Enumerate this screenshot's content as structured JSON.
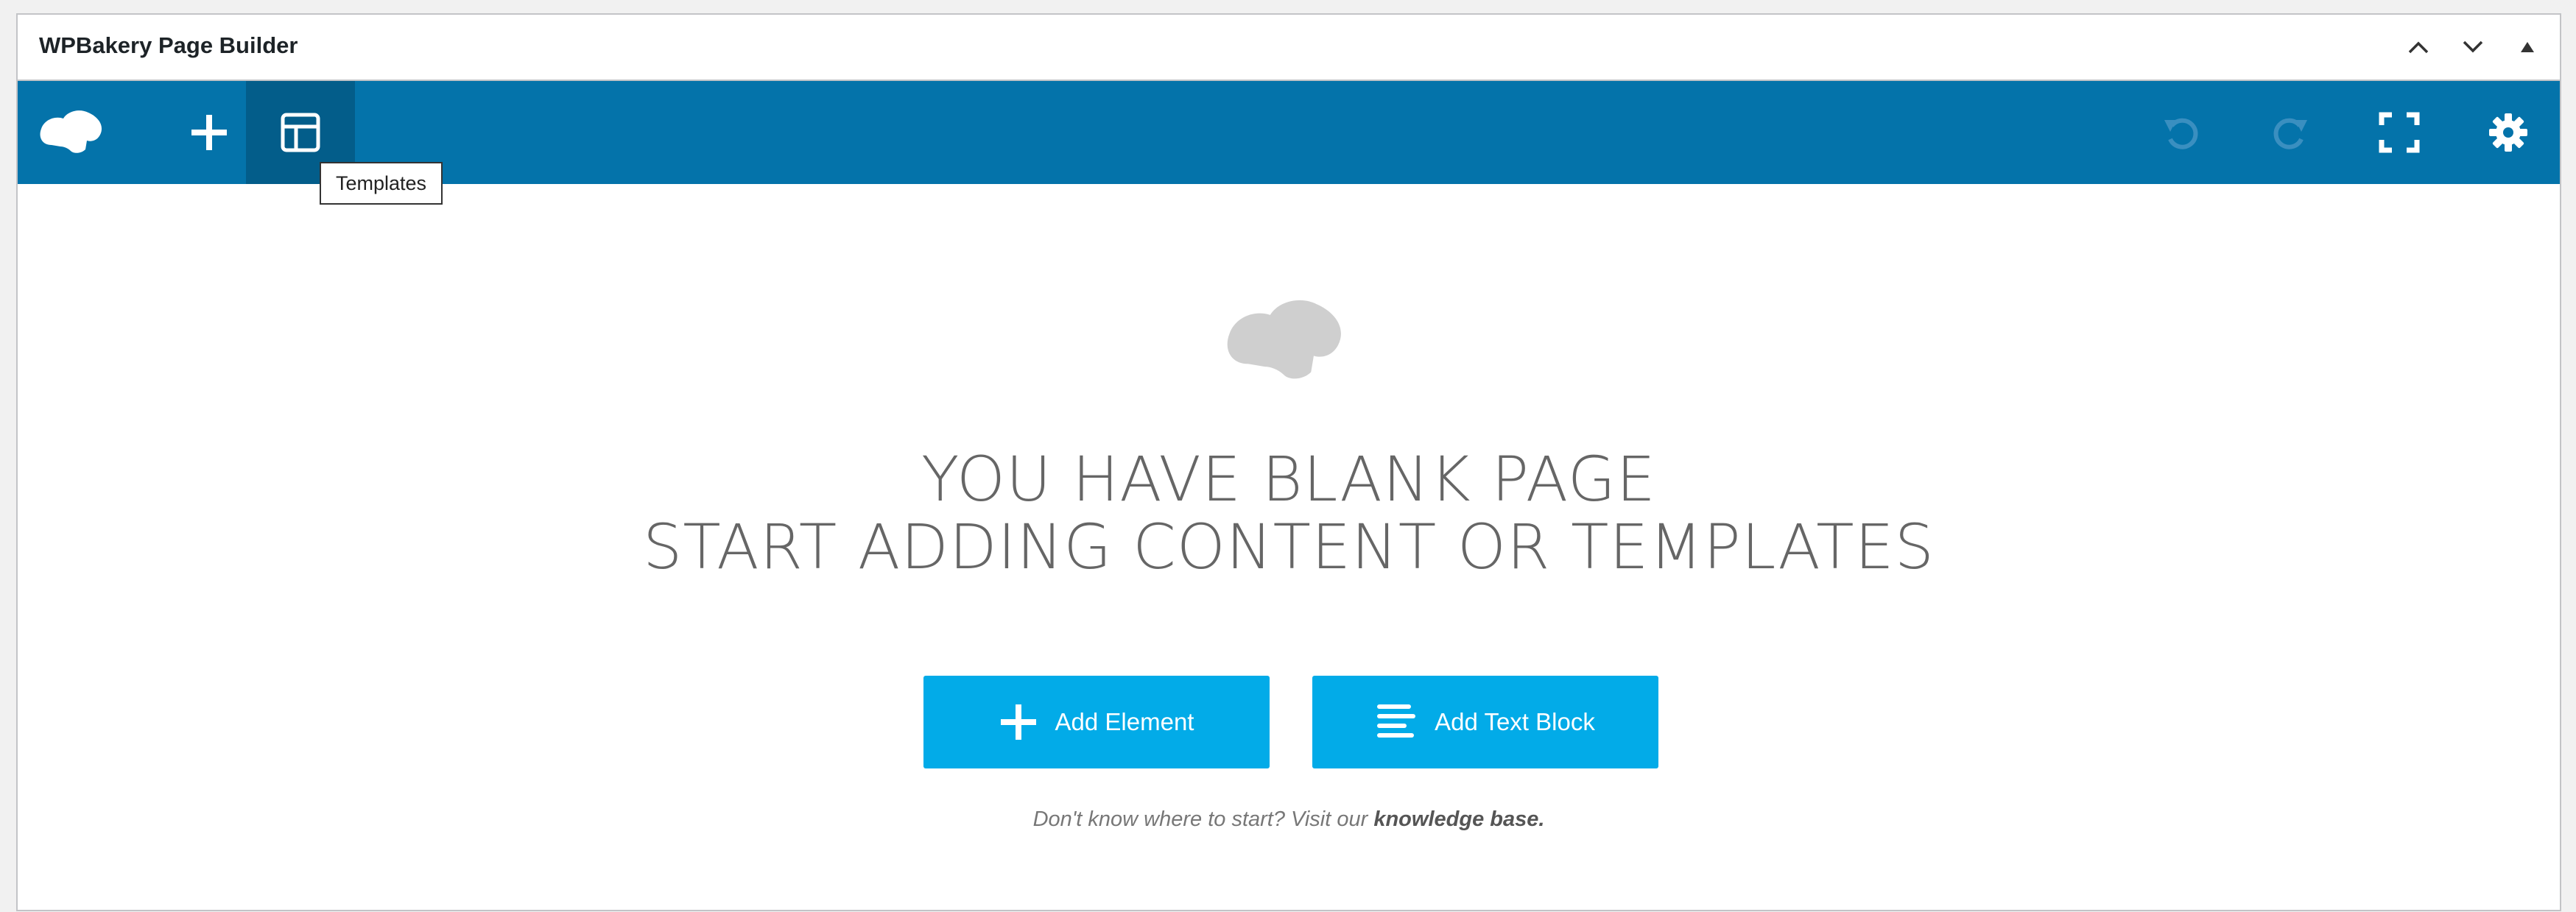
{
  "panel": {
    "title": "WPBakery Page Builder"
  },
  "header_controls": [
    "chevron-up-icon",
    "chevron-down-icon",
    "triangle-up-icon"
  ],
  "toolbar": {
    "bg_color": "#0473aa",
    "active_color": "#035d8a",
    "left_buttons": [
      "logo-icon",
      "add-icon",
      "templates-icon"
    ],
    "right_buttons": [
      "undo-icon",
      "redo-icon",
      "fullscreen-icon",
      "settings-icon"
    ],
    "tooltip": "Templates"
  },
  "empty_state": {
    "logo": "cloud-logo-icon",
    "headline_line1": "YOU HAVE BLANK PAGE",
    "headline_line2": "START ADDING CONTENT OR TEMPLATES",
    "add_element_label": "Add Element",
    "add_text_block_label": "Add Text Block",
    "help_prefix": "Don't know where to start? Visit our",
    "help_link": "knowledge base."
  },
  "colors": {
    "accent": "#02abe8",
    "heading": "#666666"
  }
}
